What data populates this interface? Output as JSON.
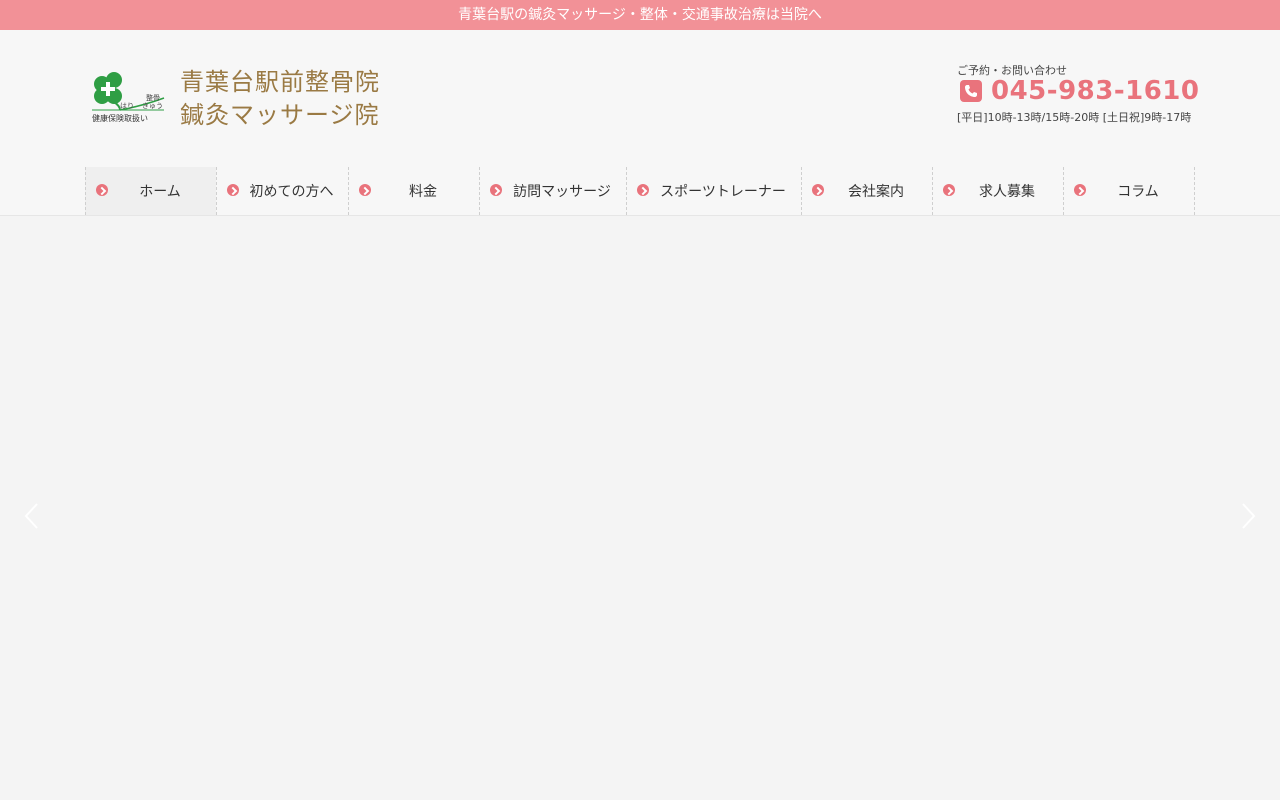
{
  "topbar": {
    "text": "青葉台駅の鍼灸マッサージ・整体・交通事故治療は当院へ"
  },
  "logo": {
    "line1": "青葉台駅前整骨院",
    "line2": "鍼灸マッサージ院",
    "badge_top": "整骨",
    "badge_mid_left": "はり",
    "badge_mid_right": "きゅう",
    "badge_bottom": "健康保険取扱い",
    "icon": "clover-cross-icon",
    "clover_color": "#2f9e44"
  },
  "contact": {
    "label": "ご予約・お問い合わせ",
    "phone": "045-983-1610",
    "hours": "[平日]10時-13時/15時-20時 [土日祝]9時-17時",
    "icon": "phone-icon"
  },
  "nav": {
    "items": [
      {
        "label": "ホーム",
        "active": true
      },
      {
        "label": "初めての方へ",
        "active": false
      },
      {
        "label": "料金",
        "active": false
      },
      {
        "label": "訪問マッサージ",
        "active": false
      },
      {
        "label": "スポーツトレーナー",
        "active": false
      },
      {
        "label": "会社案内",
        "active": false
      },
      {
        "label": "求人募集",
        "active": false
      },
      {
        "label": "コラム",
        "active": false
      }
    ]
  },
  "slider": {
    "prev_icon": "chevron-left-icon",
    "next_icon": "chevron-right-icon"
  },
  "colors": {
    "topbar": "#f29197",
    "accent": "#e9737c",
    "logo_text": "#9a7a44",
    "background": "#f4f4f4"
  }
}
